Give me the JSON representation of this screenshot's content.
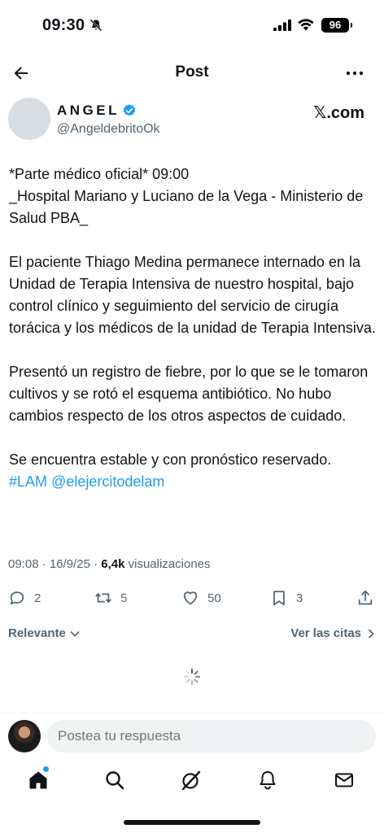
{
  "status_bar": {
    "time": "09:30",
    "battery": "96"
  },
  "nav": {
    "title": "Post"
  },
  "author": {
    "name": "ANGEL",
    "handle": "@AngeldebritoOk",
    "brand": "𝕏.com"
  },
  "tweet": {
    "paragraphs": [
      "*Parte médico oficial* 09:00\n_Hospital Mariano y Luciano de la Vega - Ministerio de Salud PBA_",
      "El paciente Thiago Medina permanece internado en la Unidad de Terapia Intensiva de nuestro hospital, bajo control clínico y seguimiento del servicio de cirugía torácica y los médicos de la unidad de Terapia Intensiva.",
      "Presentó un registro de fiebre, por lo que se le tomaron cultivos y se rotó el esquema antibiótico. No hubo cambios respecto de los otros aspectos de cuidado.",
      "Se encuentra estable y con pronóstico reservado."
    ],
    "hashtag": "#LAM",
    "mention": "@elejercitodelam"
  },
  "meta": {
    "timestamp": "09:08 · 16/9/25 · ",
    "views_count": "6,4k",
    "views_label": " visualizaciones"
  },
  "actions": {
    "replies": "2",
    "reposts": "5",
    "likes": "50",
    "bookmarks": "3"
  },
  "sort": {
    "left_label": "Relevante",
    "right_label": "Ver las citas"
  },
  "reply": {
    "placeholder": "Postea tu respuesta"
  },
  "colors": {
    "accent": "#1d9bf0",
    "text": "#0f1419",
    "muted": "#536471"
  }
}
